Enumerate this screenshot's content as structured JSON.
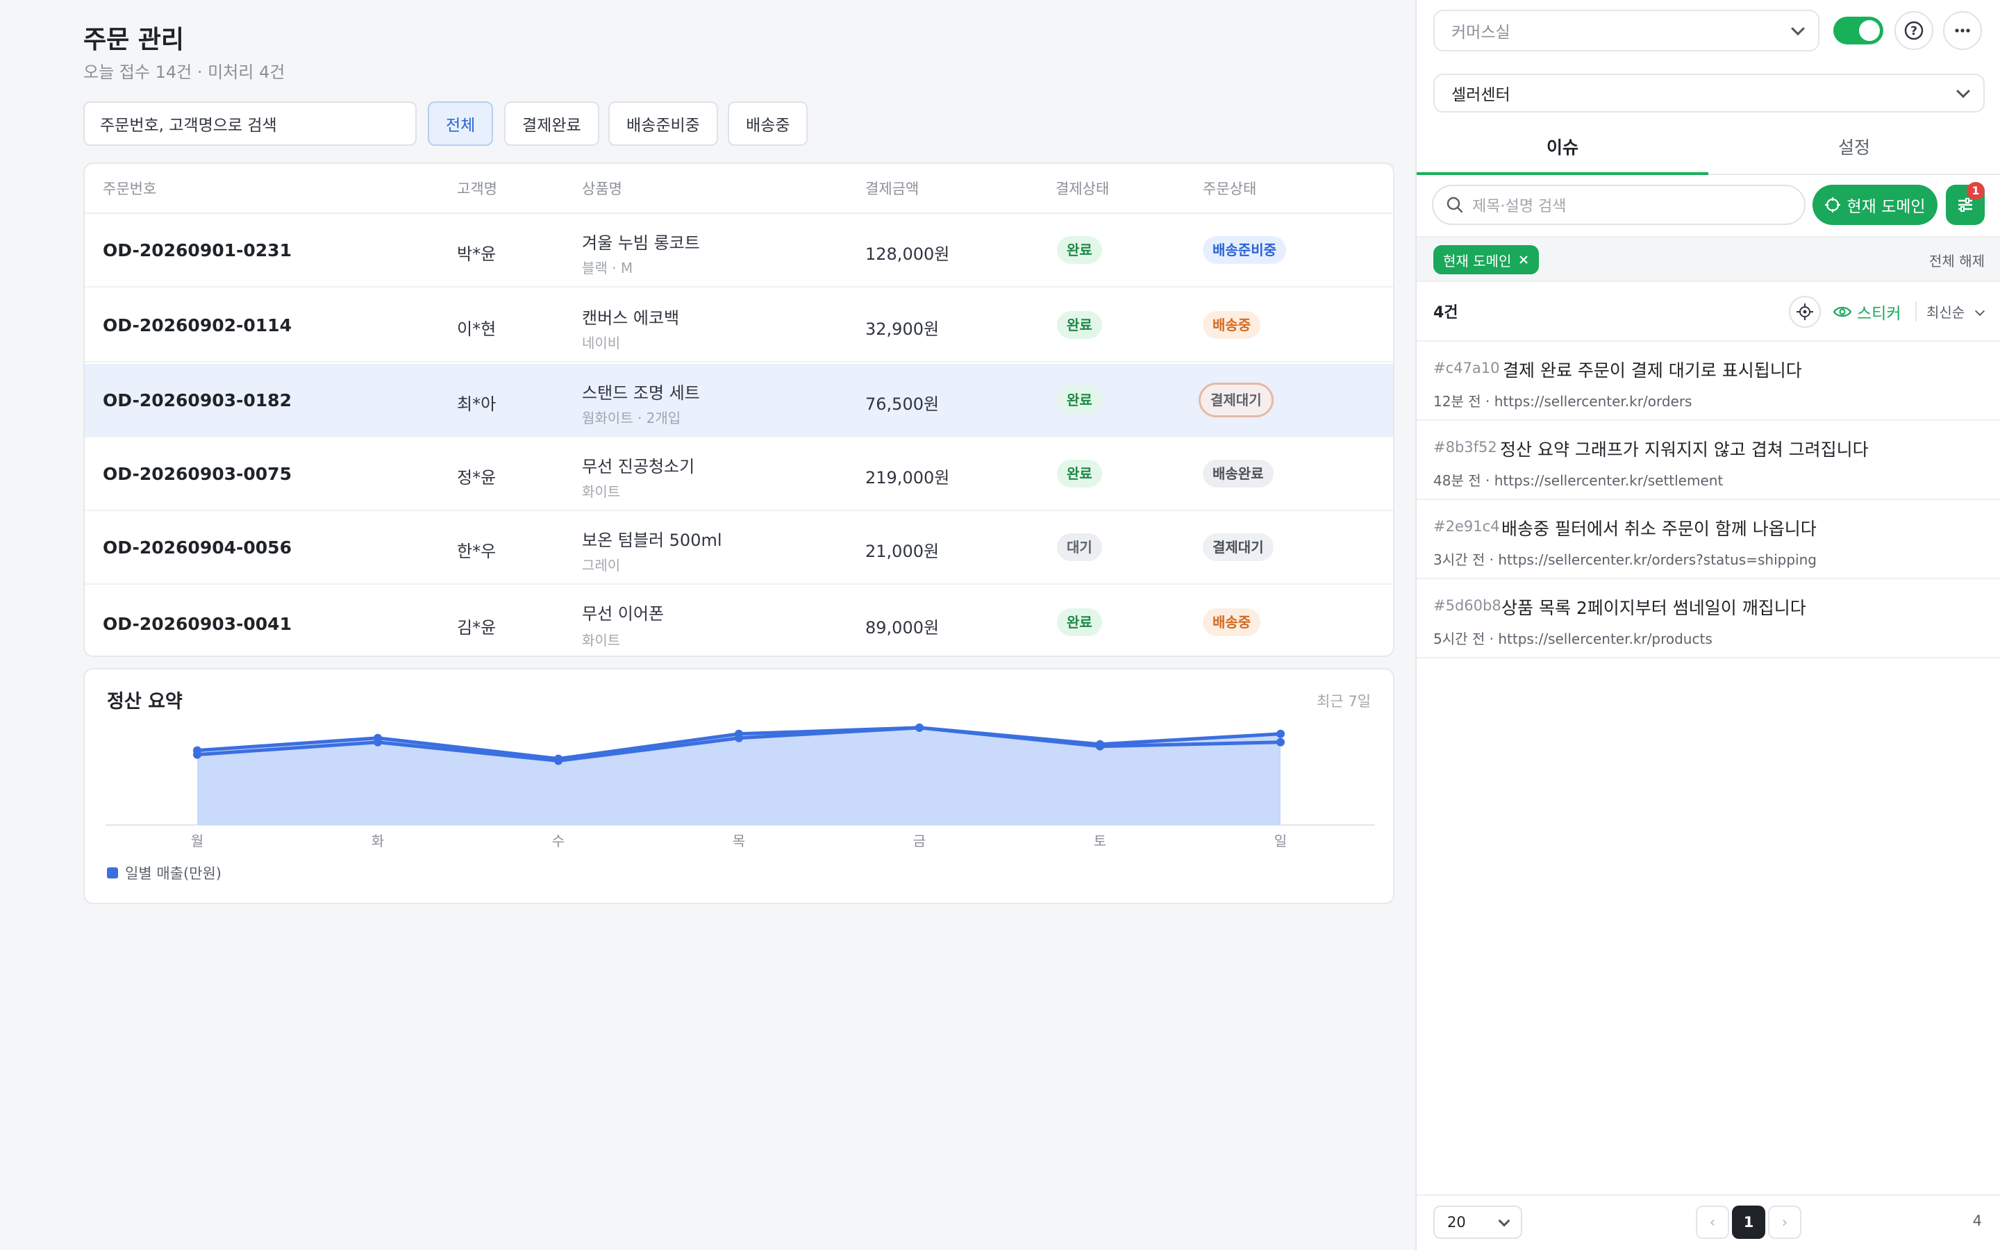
{
  "main": {
    "title": "주문 관리",
    "subtitle": "오늘 접수 14건 · 미처리 4건",
    "search_value": "주문번호, 고객명으로 검색",
    "filters": [
      "전체",
      "결제완료",
      "배송준비중",
      "배송중"
    ],
    "active_filter": "전체",
    "table": {
      "columns": [
        "주문번호",
        "고객명",
        "상품명",
        "결제금액",
        "결제상태",
        "주문상태"
      ],
      "rows": [
        {
          "order": "OD-20260901-0231",
          "customer": "박*윤",
          "product": "겨울 누빔 롱코트",
          "option": "블랙 · M",
          "amount": "128,000원",
          "pay": "완료",
          "status": "배송준비중"
        },
        {
          "order": "OD-20260902-0114",
          "customer": "이*현",
          "product": "캔버스 에코백",
          "option": "네이비",
          "amount": "32,900원",
          "pay": "완료",
          "status": "배송중"
        },
        {
          "order": "OD-20260903-0182",
          "customer": "최*아",
          "product": "스탠드 조명 세트",
          "option": "웜화이트 · 2개입",
          "amount": "76,500원",
          "pay": "완료",
          "status": "결제대기"
        },
        {
          "order": "OD-20260903-0075",
          "customer": "정*윤",
          "product": "무선 진공청소기",
          "option": "화이트",
          "amount": "219,000원",
          "pay": "완료",
          "status": "배송완료"
        },
        {
          "order": "OD-20260904-0056",
          "customer": "한*우",
          "product": "보온 텀블러 500ml",
          "option": "그레이",
          "amount": "21,000원",
          "pay": "대기",
          "status": "결제대기"
        },
        {
          "order": "OD-20260903-0041",
          "customer": "김*윤",
          "product": "무선 이어폰",
          "option": "화이트",
          "amount": "89,000원",
          "pay": "완료",
          "status": "배송중"
        }
      ]
    },
    "settlement": {
      "title": "정산 요약",
      "range": "최근 7일",
      "legend": "일별 매출(만원)"
    }
  },
  "chart_data": {
    "type": "area",
    "title": "정산 요약",
    "categories": [
      "월",
      "화",
      "수",
      "목",
      "금",
      "토",
      "일"
    ],
    "series": [
      {
        "name": "일별 매출(만원)",
        "values": [
          76,
          82,
          72,
          84,
          87,
          79,
          84
        ]
      },
      {
        "values": [
          74,
          80,
          71,
          82,
          87,
          78,
          80
        ]
      }
    ],
    "ylim": [
      40,
      95
    ],
    "grid": false,
    "legend_position": "bottom-left",
    "colors": {
      "line": "#3b6fe0",
      "fill": "#c9dafa"
    }
  },
  "panel": {
    "workspace": "커머스실",
    "site": "셀러센터",
    "toggle_on": true,
    "help_icon": "question-circle-icon",
    "more_icon": "ellipsis-icon",
    "tabs": [
      "이슈",
      "설정"
    ],
    "active_tab": "이슈",
    "search_placeholder": "제목·설명 검색",
    "domain_button": "현재 도메인",
    "filter_badge": "1",
    "chip_label": "현재 도메인",
    "clear_all": "전체 해제",
    "count": "4건",
    "sticker_label": "스티커",
    "sort_label": "최신순",
    "issues": [
      {
        "id": "#c47a10",
        "title": "결제 완료 주문이 결제 대기로 표시됩니다",
        "time": "12분 전",
        "url": "https://sellercenter.kr/orders"
      },
      {
        "id": "#8b3f52",
        "title": "정산 요약 그래프가 지워지지 않고 겹쳐 그려집니다",
        "time": "48분 전",
        "url": "https://sellercenter.kr/settlement"
      },
      {
        "id": "#2e91c4",
        "title": "배송중 필터에서 취소 주문이 함께 나옵니다",
        "time": "3시간 전",
        "url": "https://sellercenter.kr/orders?status=shipping"
      },
      {
        "id": "#5d60b8",
        "title": "상품 목록 2페이지부터 썸네일이 깨집니다",
        "time": "5시간 전",
        "url": "https://sellercenter.kr/products"
      }
    ],
    "page_size": "20",
    "current_page": "1",
    "total": "4",
    "accent": "#1aa85a"
  }
}
